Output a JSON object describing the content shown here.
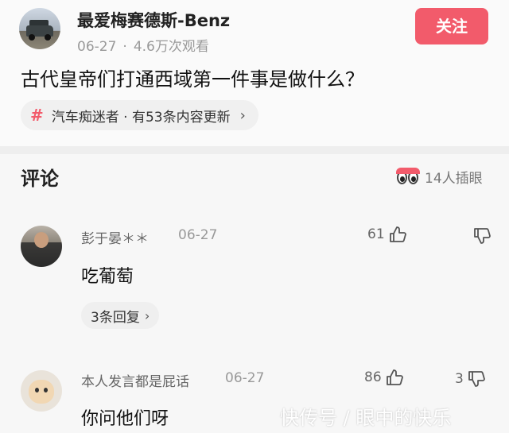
{
  "post": {
    "author_name": "最爱梅赛德斯-Benz",
    "date": "06-27",
    "separator": "·",
    "views": "4.6万次观看",
    "follow_label": "关注",
    "title": "古代皇帝们打通西域第一件事是做什么？",
    "topic": {
      "hash_symbol": "#",
      "label": "汽车痴迷者 · 有53条内容更新",
      "chevron": "›"
    }
  },
  "comments_section": {
    "title": "评论",
    "reactions_label": "14人插眼"
  },
  "comments": [
    {
      "name": "彭于晏＊＊",
      "date": "06-27",
      "text": "吃葡萄",
      "likes": "61",
      "dislikes": "",
      "reply_label": "3条回复",
      "reply_chevron": "›"
    },
    {
      "name": "本人发言都是屁话",
      "date": "06-27",
      "text": "你问他们呀",
      "likes": "86",
      "dislikes": "3"
    }
  ],
  "watermark": "快传号 / 眼中的快乐",
  "icons": {
    "hash": "hash-icon",
    "eyes": "eyes-icon",
    "like": "thumbs-up-icon",
    "dislike": "thumbs-down-icon"
  },
  "colors": {
    "accent": "#f25b6b",
    "background": "#f7f7f7",
    "muted_text": "#999999"
  }
}
